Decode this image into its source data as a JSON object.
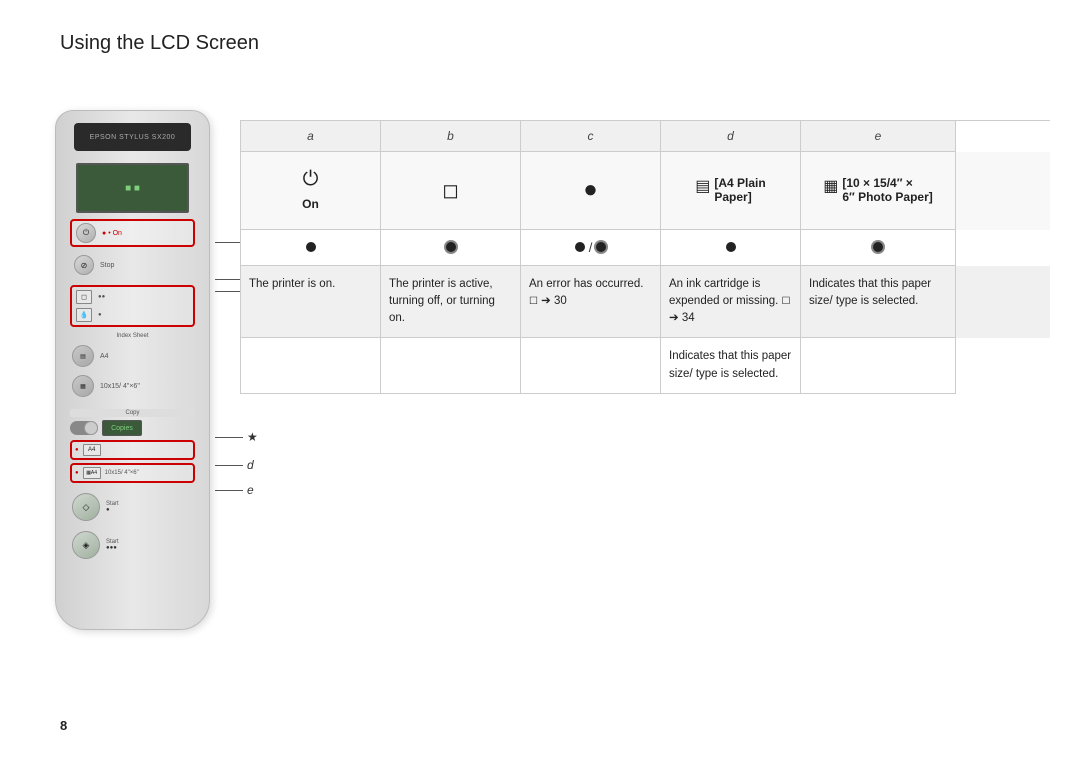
{
  "page": {
    "title": "Using the LCD Screen",
    "number": "8"
  },
  "table": {
    "columns": [
      {
        "letter": "a",
        "icon": "⏻",
        "icon_label": "On",
        "dot": "filled",
        "desc": "The printer is on."
      },
      {
        "letter": "b",
        "icon": "☐",
        "icon_label": "",
        "dot": "blink",
        "desc": "The printer is active, turning off, or turning on."
      },
      {
        "letter": "c",
        "icon": "●",
        "icon_label": "",
        "dot": "slash",
        "desc": "An error has occurred. ☐ ➔ 30"
      },
      {
        "letter": "d",
        "icon": "●",
        "icon_label": "[A4 Plain Paper]",
        "dot": "blink",
        "desc": "An ink cartridge is expended or missing. ☐ ➔ 34"
      },
      {
        "letter": "e",
        "icon": "▦",
        "icon_label": "[10 × 15/4″ × 6″ Photo Paper]",
        "dot": "filled",
        "desc": "Indicates that this paper size/type is selected."
      }
    ],
    "col_d_full": "Indicates that this paper size/ type is selected.",
    "col_d_label1": "[A4 Plain",
    "col_d_label2": "Paper]",
    "col_e_label1": "[10 × 15/4″ ×",
    "col_e_label2": "6″ Photo Paper]"
  },
  "printer": {
    "brand": "EPSON STYLUS SX200",
    "labels": {
      "on": "• On",
      "stop": "Stop",
      "index_sheet": "Index Sheet",
      "a4": "A4",
      "size_10x15": "10x15/ 4\"×6\"",
      "copy": "Copy",
      "copies": "Copies",
      "start_bw": "Start",
      "start_color": "Start"
    }
  },
  "labels": {
    "a": "a",
    "b": "b",
    "c": "c",
    "d": "d",
    "e": "e",
    "star": "★"
  }
}
